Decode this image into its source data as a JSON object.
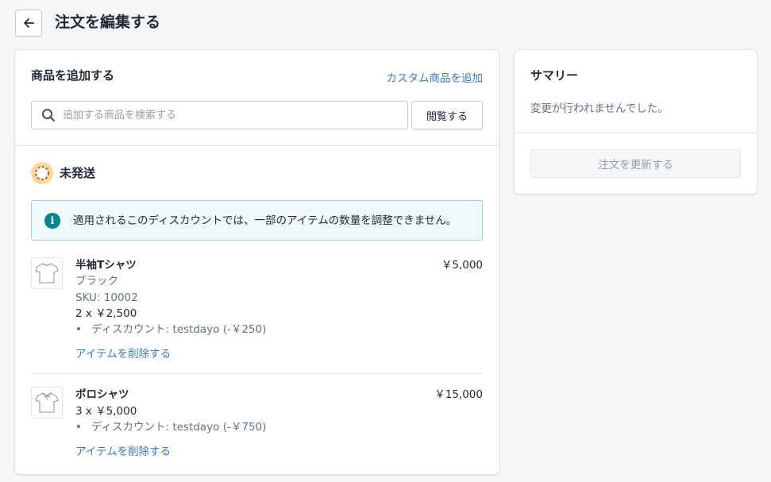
{
  "header": {
    "title": "注文を編集する"
  },
  "add_products": {
    "title": "商品を追加する",
    "custom_link": "カスタム商品を追加",
    "search_placeholder": "追加する商品を検索する",
    "browse_label": "閲覧する"
  },
  "fulfillment": {
    "status_label": "未発送",
    "notice": "適用されるこのディスカウントでは、一部のアイテムの数量を調整できません。",
    "items": [
      {
        "name": "半袖Tシャツ",
        "variant": "ブラック",
        "sku": "SKU: 10002",
        "qty_price": "2 x ￥2,500",
        "discount": "ディスカウント: testdayo (-￥250)",
        "total": "￥5,000",
        "remove_label": "アイテムを削除する",
        "icon": "tshirt-icon"
      },
      {
        "name": "ポロシャツ",
        "qty_price": "3 x ￥5,000",
        "discount": "ディスカウント: testdayo (-￥750)",
        "total": "￥15,000",
        "remove_label": "アイテムを削除する",
        "icon": "polo-shirt-icon"
      }
    ]
  },
  "summary": {
    "title": "サマリー",
    "message": "変更が行われませんでした。",
    "update_button": "注文を更新する"
  },
  "colors": {
    "link": "#3b79bf",
    "banner_bg": "#eef9f9",
    "banner_border": "#9cd4e0",
    "info_icon": "#00848e",
    "status_badge": "#ffd79d"
  }
}
